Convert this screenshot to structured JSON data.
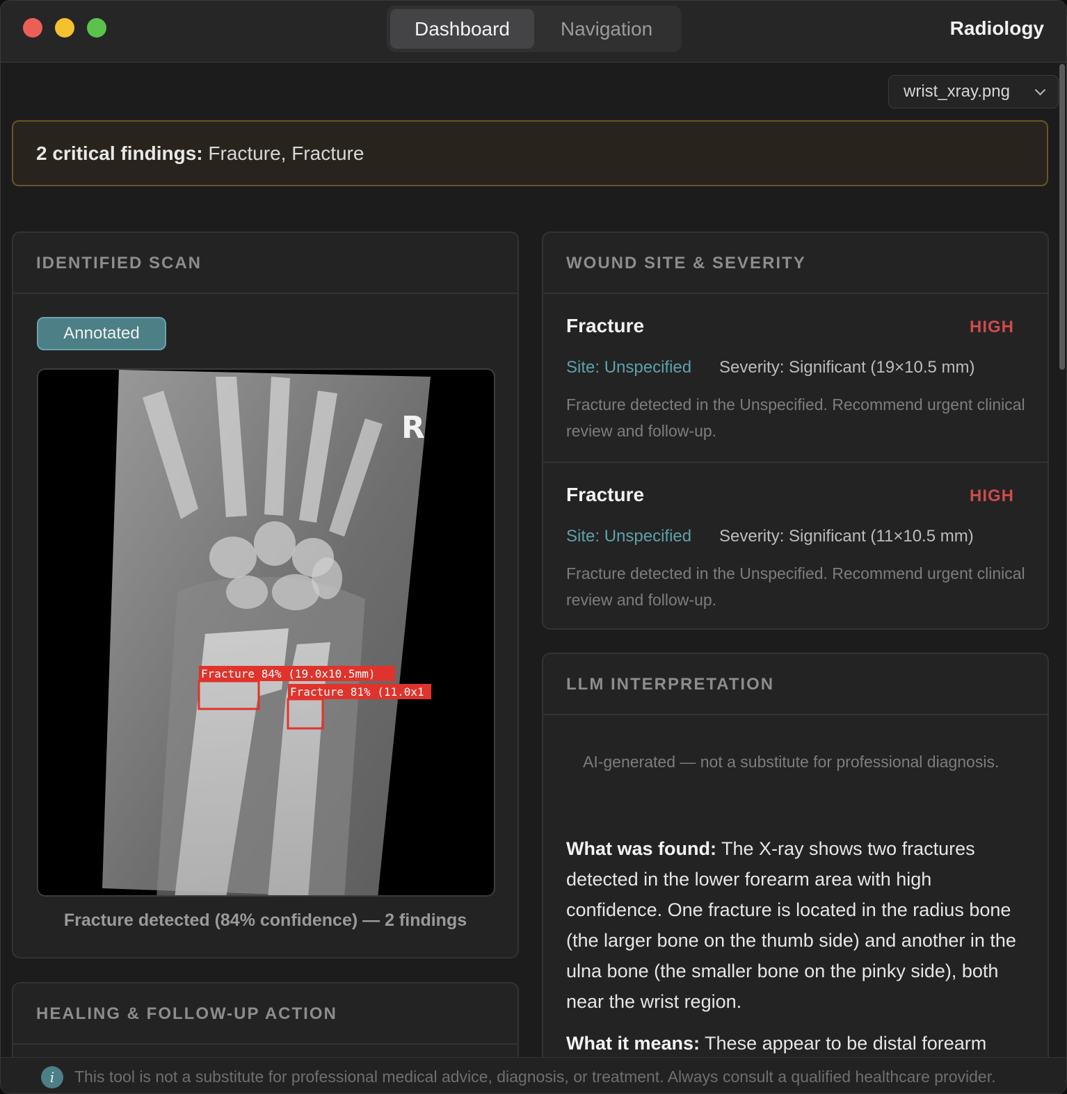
{
  "titlebar": {
    "tabs": [
      {
        "label": "Dashboard",
        "active": true
      },
      {
        "label": "Navigation",
        "active": false
      }
    ],
    "app_title": "Radiology"
  },
  "file_select": {
    "value": "wrist_xray.png",
    "icon": "chevron-down-icon"
  },
  "alert": {
    "count_label": "2 critical findings:",
    "items_text": "Fracture, Fracture",
    "border_color": "#6a5429"
  },
  "scan": {
    "header": "IDENTIFIED SCAN",
    "badge": "Annotated",
    "annotations": [
      {
        "label": "Fracture 84% (19.0x10.5mm)"
      },
      {
        "label": "Fracture 81% (11.0x1"
      }
    ],
    "marker": "R",
    "caption": "Fracture detected (84% confidence) — 2 findings"
  },
  "wound": {
    "header": "WOUND SITE & SEVERITY",
    "findings": [
      {
        "title": "Fracture",
        "level": "HIGH",
        "site": "Site: Unspecified",
        "severity": "Severity: Significant (19×10.5 mm)",
        "description": "Fracture detected in the Unspecified. Recommend urgent clinical review and follow-up."
      },
      {
        "title": "Fracture",
        "level": "HIGH",
        "site": "Site: Unspecified",
        "severity": "Severity: Significant (11×10.5 mm)",
        "description": "Fracture detected in the Unspecified. Recommend urgent clinical review and follow-up."
      }
    ]
  },
  "healing": {
    "header": "HEALING & FOLLOW-UP ACTION"
  },
  "llm": {
    "header": "LLM INTERPRETATION",
    "note": "AI-generated — not a substitute for professional diagnosis.",
    "found_label": "What was found:",
    "found_text": " The X-ray shows two fractures detected in the lower forearm area with high confidence. One fracture is located in the radius bone (the larger bone on the thumb side) and another in the ulna bone (the smaller bone on the pinky side), both near the wrist region.",
    "means_label": "What it means:",
    "means_text": " These appear to be distal forearm"
  },
  "footer": {
    "icon": "info-icon",
    "text": "This tool is not a substitute for professional medical advice, diagnosis, or treatment. Always consult a qualified healthcare provider."
  },
  "colors": {
    "accent": "#4c7f86",
    "critical": "#cf4b4b",
    "site": "#5ea2a8",
    "annotation": "#e0332b"
  }
}
